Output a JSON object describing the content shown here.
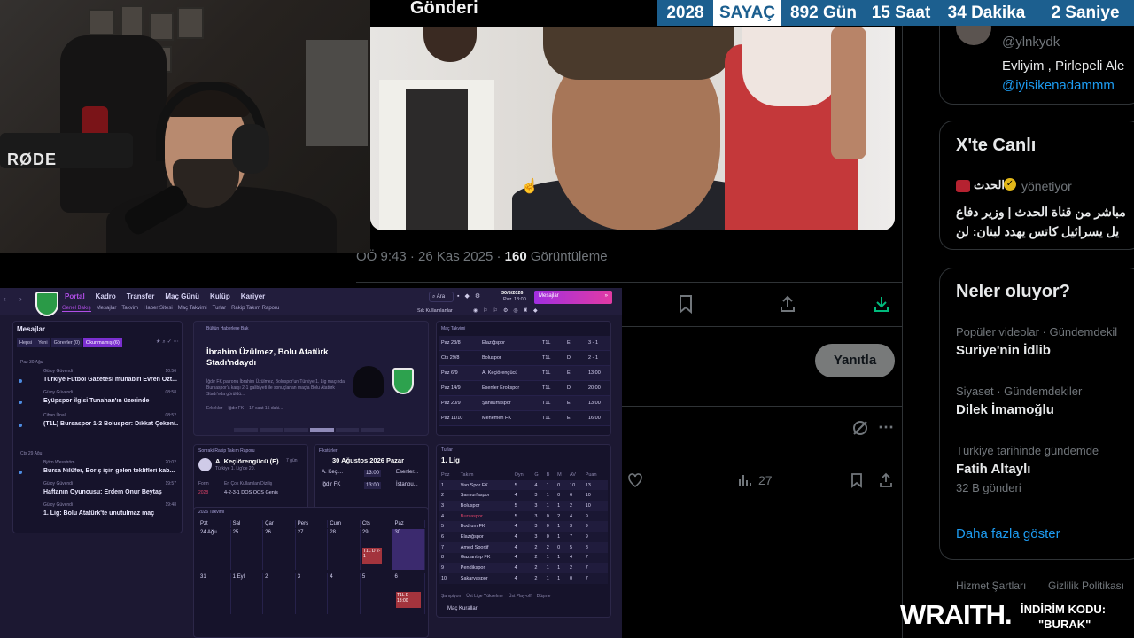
{
  "counter": {
    "year": "2028",
    "label": "SAYAÇ",
    "days": "892 Gün",
    "hours": "15 Saat",
    "minutes": "34 Dakika",
    "seconds": "2 Saniye"
  },
  "webcam": {
    "mic_brand": "RØDE"
  },
  "post": {
    "overlay_title": "Gönderi",
    "time": "ÖÖ 9:43",
    "date": "26 Kas 2025",
    "views_count": "160",
    "views_label": "Görüntüleme",
    "reply_label": "Yanıtla",
    "stat_count": "27"
  },
  "sidebar": {
    "top_user": {
      "handle": "@ylnkydk",
      "text": "Evliyim , Pirlepeli Ale",
      "mention": "@iyisikenadammm"
    },
    "live": {
      "title": "X'te Canlı",
      "channel": "الحدث",
      "role": "yönetiyor",
      "line1": "مباشر من قناة الحدث | وزير دفاع",
      "line2": "يل يسرائيل كاتس يهدد لبنان: لن"
    },
    "happening": {
      "title": "Neler oluyor?",
      "trends": [
        {
          "category": "Popüler videolar · Gündemdekil",
          "name": "Suriye'nin İdlib",
          "extra": ""
        },
        {
          "category": "Siyaset · Gündemdekiler",
          "name": "Dilek İmamoğlu",
          "extra": ""
        },
        {
          "category": "Türkiye tarihinde gündemde",
          "name": "Fatih Altaylı",
          "extra": "32 B gönderi"
        }
      ],
      "show_more": "Daha fazla göster"
    },
    "footer": {
      "terms": "Hizmet Şartları",
      "privacy": "Gizlilik Politikası"
    }
  },
  "fm": {
    "nav": [
      "Portal",
      "Kadro",
      "Transfer",
      "Maç Günü",
      "Kulüp",
      "Kariyer"
    ],
    "subnav": [
      "Genel Bakış",
      "Mesajlar",
      "Takvim",
      "Haber Sitesi",
      "Maç Takvimi",
      "Turlar",
      "Rakip Takım Raporu"
    ],
    "search": "Ara",
    "date_top": "30/8/2026",
    "date_bottom": "Paz",
    "time": "13:00",
    "continue": "Mesajlar",
    "quick": "Sık Kullanılanlar",
    "messages": {
      "title": "Mesajlar",
      "filters": [
        "Hepsi",
        "Yeni",
        "Görevler (0)",
        "Okunmamış (6)"
      ],
      "group1": "Paz 30 Ağu",
      "group2": "Cts 29 Ağu",
      "items": [
        {
          "from": "Güloy Güvendi",
          "time": "10:56",
          "subject": "Türkiye Futbol Gazetesi muhabiri Evren Özt..."
        },
        {
          "from": "Güloy Güvendi",
          "time": "08:58",
          "subject": "Eyüpspor ilgisi Tunahan'ın üzerinde"
        },
        {
          "from": "Cihan Ünal",
          "time": "08:52",
          "subject": "(T1L) Bursaspor 1-2 Boluspor: Dikkat Çekeni..."
        },
        {
          "from": "Björn Wesström",
          "time": "20:02",
          "subject": "Bursa Nilüfer, Borış için gelen teklifleri kab..."
        },
        {
          "from": "Güloy Güvendi",
          "time": "19:57",
          "subject": "Haftanın Oyuncusu: Erdem Onur Beytaş"
        },
        {
          "from": "Güloy Güvendi",
          "time": "19:48",
          "subject": "1. Lig: Bolu Atatürk'te unutulmaz maç"
        }
      ]
    },
    "news": {
      "tag": "Bültün Haberlere Bak",
      "headline": "İbrahim Üzülmez, Bolu Atatürk Stadı'ndaydı",
      "body": "İğdır FK patronu İbrahim Üzülmez, Boluspor'un Türkiye 1. Lig maçında Bursaspor'a karşı 2-1 galibiyeti ile sonuçlanan maçta Bolu Atatürk Stadı'nda görüldü...",
      "footer_a": "Erkekler",
      "footer_b": "Iğdır FK",
      "footer_c": "17 saat 15 daki..."
    },
    "fixtures": {
      "title": "Maç Takvimi",
      "rows": [
        {
          "date": "Paz 23/8",
          "team": "Elazığspor",
          "comp": "T1L",
          "venue": "E",
          "res": "3 - 1"
        },
        {
          "date": "Cts 29/8",
          "team": "Boluspor",
          "comp": "T1L",
          "venue": "D",
          "res": "2 - 1"
        },
        {
          "date": "Paz 6/9",
          "team": "A. Keçiörengücü",
          "comp": "T1L",
          "venue": "E",
          "res": "13:00"
        },
        {
          "date": "Paz 14/9",
          "team": "Esenler Erokspor",
          "comp": "T1L",
          "venue": "D",
          "res": "20:00"
        },
        {
          "date": "Paz 20/9",
          "team": "Şanlıurfaspor",
          "comp": "T1L",
          "venue": "E",
          "res": "13:00"
        },
        {
          "date": "Paz 11/10",
          "team": "Menemen FK",
          "comp": "T1L",
          "venue": "E",
          "res": "16:00"
        }
      ]
    },
    "opponent": {
      "title": "Sonraki Rakip Takım Raporu",
      "team": "A. Keçiörengücü (E)",
      "when": "7 gün",
      "league": "Türkiye 1. Lig'de 20.",
      "form_label": "Form",
      "form_year": "2028",
      "tactic_label": "En Çok Kullanılan Diziliş",
      "tactic": "4-2-3-1 DOS OOS Geniş"
    },
    "next_match": {
      "title": "Fikstürler",
      "date": "30 Ağustos 2026 Pazar",
      "rows": [
        {
          "a": "A. Keçi...",
          "t": "13:00",
          "b": "Esenler..."
        },
        {
          "a": "Iğdır FK",
          "t": "13:00",
          "b": "İstanbu..."
        }
      ]
    },
    "league": {
      "section": "Turlar",
      "title": "1. Lig",
      "headers": [
        "Poz",
        "Takım",
        "Oyn",
        "G",
        "B",
        "M",
        "AV",
        "Puan"
      ],
      "rows": [
        [
          "1",
          "Van Spor FK",
          "5",
          "4",
          "1",
          "0",
          "10",
          "13"
        ],
        [
          "2",
          "Şanlıurfaspor",
          "4",
          "3",
          "1",
          "0",
          "6",
          "10"
        ],
        [
          "3",
          "Boluspor",
          "5",
          "3",
          "1",
          "1",
          "2",
          "10"
        ],
        [
          "4",
          "Bursaspor",
          "5",
          "3",
          "0",
          "2",
          "4",
          "9"
        ],
        [
          "5",
          "Bodrum FK",
          "4",
          "3",
          "0",
          "1",
          "3",
          "9"
        ],
        [
          "6",
          "Elazığspor",
          "4",
          "3",
          "0",
          "1",
          "7",
          "9"
        ],
        [
          "7",
          "Amed Sportif",
          "4",
          "2",
          "2",
          "0",
          "5",
          "8"
        ],
        [
          "8",
          "Gaziantep FK",
          "4",
          "2",
          "1",
          "1",
          "4",
          "7"
        ],
        [
          "9",
          "Pendikspor",
          "4",
          "2",
          "1",
          "1",
          "2",
          "7"
        ],
        [
          "10",
          "Sakaryaspor",
          "4",
          "2",
          "1",
          "1",
          "0",
          "7"
        ]
      ],
      "legend": [
        "Şampiyon",
        "Üst Lige Yükselme",
        "Üst Play-off",
        "Düşme"
      ],
      "footer": "Maç Kuralları"
    },
    "calendar": {
      "title": "2026 Takvimi",
      "days": [
        "Pzt",
        "Sal",
        "Çar",
        "Perş",
        "Cum",
        "Cts",
        "Paz"
      ],
      "week1": [
        "24 Ağu",
        "25",
        "26",
        "27",
        "28",
        "29",
        "30"
      ],
      "week2": [
        "31",
        "1 Eyl",
        "2",
        "3",
        "4",
        "5",
        "6"
      ],
      "match1": "T1L D 2-1",
      "match2": "T1L E 13:00"
    }
  },
  "promo": {
    "brand": "WRAITH.",
    "discount": "İNDİRİM KODU:",
    "code": "\"BURAK\""
  }
}
